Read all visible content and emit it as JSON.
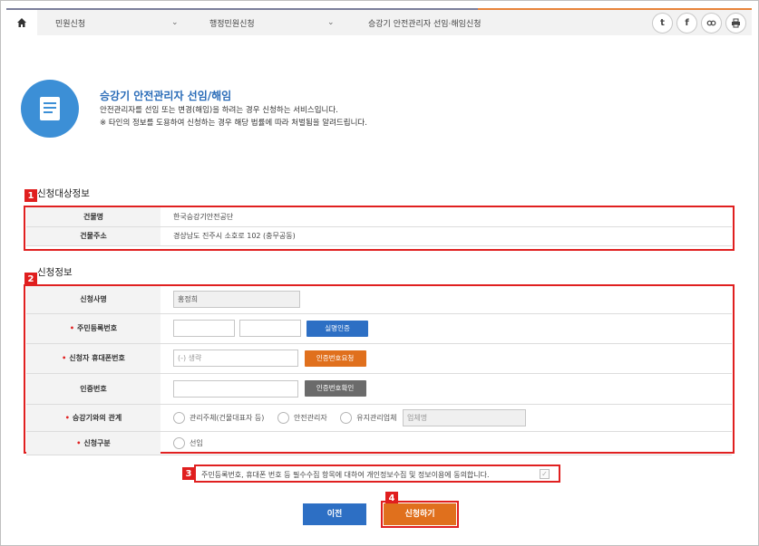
{
  "nav": {
    "home_icon": "home-icon",
    "crumb1": "민원신청",
    "crumb2": "행정민원신청",
    "crumb3": "승강기 안전관리자 선임·해임신청",
    "share_icons": [
      "twitter-icon",
      "facebook-icon",
      "link-icon",
      "print-icon"
    ]
  },
  "header": {
    "title": "승강기 안전관리자 선임/해임",
    "desc1": "안전관리자를 선임 또는 변경(해임)을 하려는 경우 신청하는 서비스입니다.",
    "desc2": "※ 타인의 정보를 도용하여 신청하는 경우 해당 법률에 따라 처벌됨을 알려드립니다."
  },
  "section1": {
    "badge": "1",
    "title": "신청대상정보",
    "rows": [
      {
        "label": "건물명",
        "value": "한국승강기안전공단"
      },
      {
        "label": "건물주소",
        "value": "경상남도 진주시 소호로 102 (충무공동)"
      }
    ]
  },
  "section2": {
    "badge": "2",
    "title": "신청정보",
    "applicant": {
      "label": "신청사명",
      "value": "홍정희"
    },
    "rrn": {
      "label": "주민등록번호",
      "button": "실명인증"
    },
    "phone": {
      "label": "신청자 휴대폰번호",
      "placeholder": "(-) 생략",
      "button": "인증번호요청"
    },
    "auth": {
      "label": "인증번호",
      "button": "인증번호확인"
    },
    "relation": {
      "label": "승강기와의 관계",
      "options": [
        "관리주체(건물대표자 등)",
        "안전관리자",
        "유지관리업체"
      ],
      "company_placeholder": "업체명"
    },
    "type": {
      "label": "신청구분",
      "option": "선임"
    }
  },
  "agree": {
    "badge": "3",
    "text": "주민등록번호, 휴대폰 번호 등 필수수집 항목에 대하여 개인정보수집 및 정보이용에 동의합니다."
  },
  "buttons": {
    "badge": "4",
    "prev": "이전",
    "submit": "신청하기"
  },
  "colors": {
    "accent_blue": "#2d6fc4",
    "accent_orange": "#e0701d",
    "highlight_red": "#e02020"
  }
}
